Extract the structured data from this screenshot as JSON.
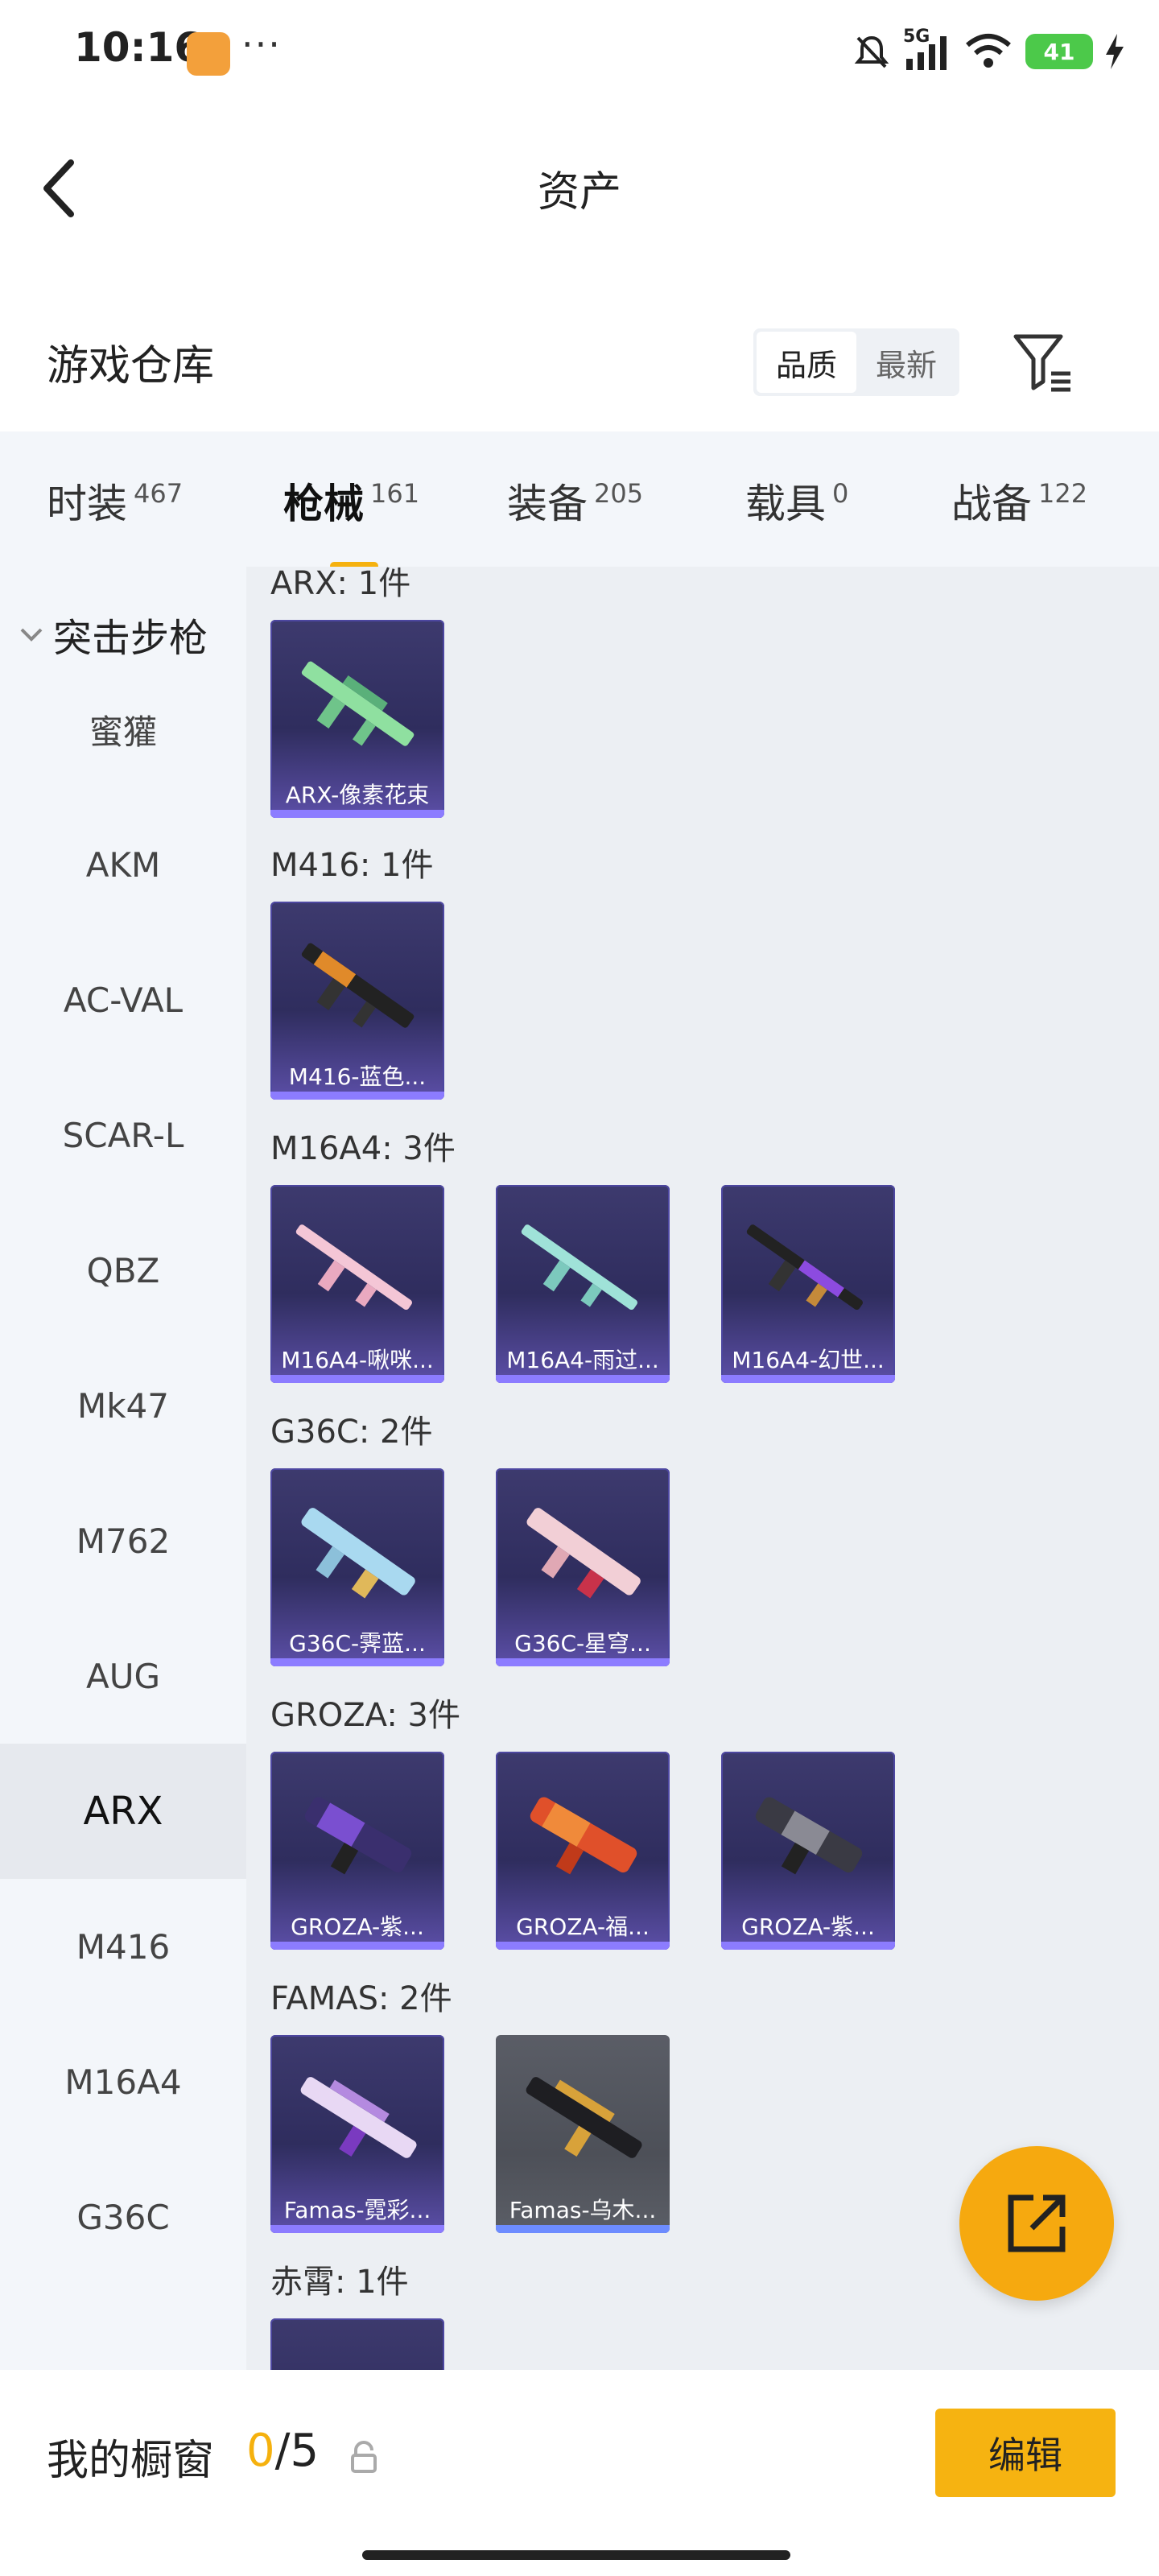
{
  "status_bar": {
    "time": "10:16",
    "dots": "···",
    "network": "5G",
    "battery": "41",
    "icons": [
      "mute-icon",
      "signal-icon",
      "wifi-icon",
      "battery-icon",
      "charging-icon"
    ]
  },
  "header": {
    "title": "资产",
    "back_icon": "back-chevron-icon"
  },
  "warehouse": {
    "title": "游戏仓库",
    "sort_options": [
      "品质",
      "最新"
    ],
    "sort_selected": "品质",
    "filter_icon": "filter-icon"
  },
  "tabs": [
    {
      "label": "时装",
      "count": "467"
    },
    {
      "label": "枪械",
      "count": "161",
      "active": true
    },
    {
      "label": "装备",
      "count": "205"
    },
    {
      "label": "载具",
      "count": "0"
    },
    {
      "label": "战备",
      "count": "122"
    }
  ],
  "sidebar": {
    "group": "突击步枪",
    "items": [
      "蜜獾",
      "AKM",
      "AC-VAL",
      "SCAR-L",
      "QBZ",
      "Mk47",
      "M762",
      "AUG",
      "ARX",
      "M416",
      "M16A4",
      "G36C"
    ],
    "active": "ARX"
  },
  "groups": [
    {
      "label": "ARX: 1件",
      "items": [
        "ARX-像素花束"
      ]
    },
    {
      "label": "M416: 1件",
      "items": [
        "M416-蓝色..."
      ]
    },
    {
      "label": "M16A4: 3件",
      "items": [
        "M16A4-啾咪...",
        "M16A4-雨过...",
        "M16A4-幻世..."
      ]
    },
    {
      "label": "G36C: 2件",
      "items": [
        "G36C-霁蓝...",
        "G36C-星穹..."
      ]
    },
    {
      "label": "GROZA: 3件",
      "items": [
        "GROZA-紫...",
        "GROZA-福...",
        "GROZA-紫..."
      ]
    },
    {
      "label": "FAMAS: 2件",
      "items": [
        "Famas-霓彩...",
        "Famas-乌木..."
      ]
    },
    {
      "label": "赤霄: 1件",
      "items": []
    }
  ],
  "fab_icon": "share-external-icon",
  "bottom": {
    "showcase_label": "我的橱窗",
    "current": "0",
    "sep_total": "/5",
    "lock_icon": "lock-icon",
    "edit_label": "编辑"
  },
  "colors": {
    "accent": "#f5b10e",
    "card_bg": "#2f2d5e",
    "card_bar": "#8c7cff"
  }
}
